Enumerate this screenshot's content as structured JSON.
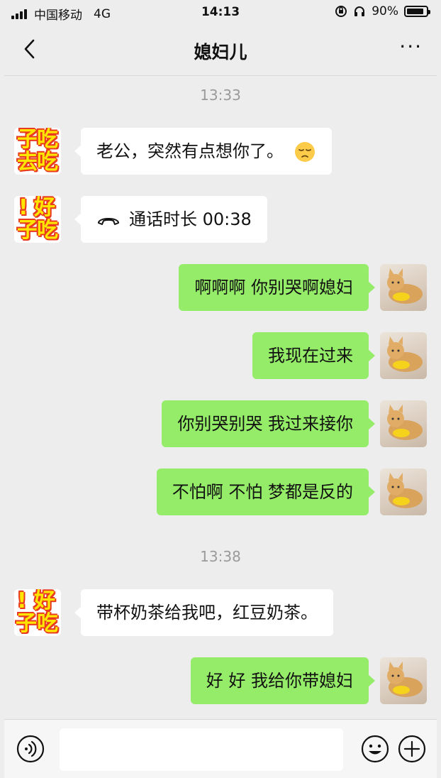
{
  "status_bar": {
    "carrier": "中国移动",
    "network": "4G",
    "time": "14:13",
    "battery": "90%",
    "battery_level": 0.9
  },
  "header": {
    "title": "媳妇儿",
    "back_icon": "chevron-left-icon",
    "more_label": "···"
  },
  "chat": {
    "time_1": "13:33",
    "time_2": "13:38",
    "messages": [
      {
        "side": "in",
        "text": "老公，突然有点想你了。"
      },
      {
        "side": "in",
        "text": "通话时长 00:38"
      },
      {
        "side": "out",
        "text": "啊啊啊 你别哭啊媳妇"
      },
      {
        "side": "out",
        "text": "我现在过来"
      },
      {
        "side": "out",
        "text": "你别哭别哭 我过来接你"
      },
      {
        "side": "out",
        "text": "不怕啊 不怕 梦都是反的"
      },
      {
        "side": "in",
        "text": "带杯奶茶给我吧，红豆奶茶。"
      },
      {
        "side": "out",
        "text": "好 好 我给你带媳妇"
      }
    ],
    "stickers": {
      "a": [
        "子",
        "吃",
        "去",
        "吃"
      ],
      "b": [
        "!",
        "好",
        "子",
        "吃"
      ],
      "c": [
        "!",
        "好",
        "子",
        "吃"
      ]
    }
  },
  "input": {
    "placeholder": ""
  },
  "colors": {
    "background": "#ededed",
    "outgoing_bubble": "#95ec69",
    "incoming_bubble": "#ffffff"
  }
}
